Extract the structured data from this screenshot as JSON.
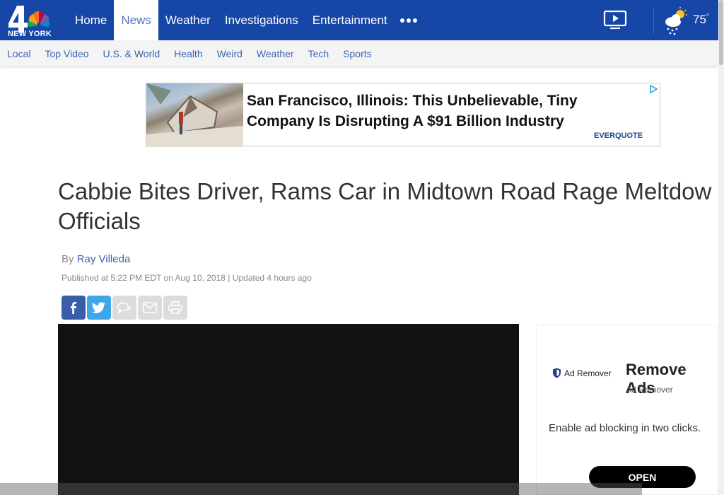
{
  "header": {
    "logo_text": "NEW YORK",
    "nav": [
      "Home",
      "News",
      "Weather",
      "Investigations",
      "Entertainment"
    ],
    "active_nav": "News",
    "temperature": "75",
    "temperature_unit": "°"
  },
  "subnav": [
    "Local",
    "Top Video",
    "U.S. & World",
    "Health",
    "Weird",
    "Weather",
    "Tech",
    "Sports"
  ],
  "ad_banner": {
    "text": "San Francisco, Illinois: This Unbelievable, Tiny Company Is Disrupting A $91 Billion Industry",
    "brand": "EVERQUOTE"
  },
  "article": {
    "headline": "Cabbie Bites Driver, Rams Car in Midtown Road Rage Meltdow",
    "headline_line2": "Officials",
    "byline_prefix": "By ",
    "author": "Ray Villeda",
    "published": "Published at 5:22 PM EDT on Aug 10, 2018 | Updated 4 hours ago"
  },
  "share_buttons": [
    "facebook-icon",
    "twitter-icon",
    "comment-icon",
    "email-icon",
    "print-icon"
  ],
  "side_ad": {
    "logo_label": "Ad Remover",
    "title": "Remove Ads",
    "subtitle": "Ad Remover",
    "description": "Enable ad blocking in two clicks.",
    "button": "OPEN"
  },
  "colors": {
    "header_bg": "#1646a6",
    "link": "#3c63b0",
    "facebook": "#3b5ca8",
    "twitter": "#3ea7e8"
  }
}
